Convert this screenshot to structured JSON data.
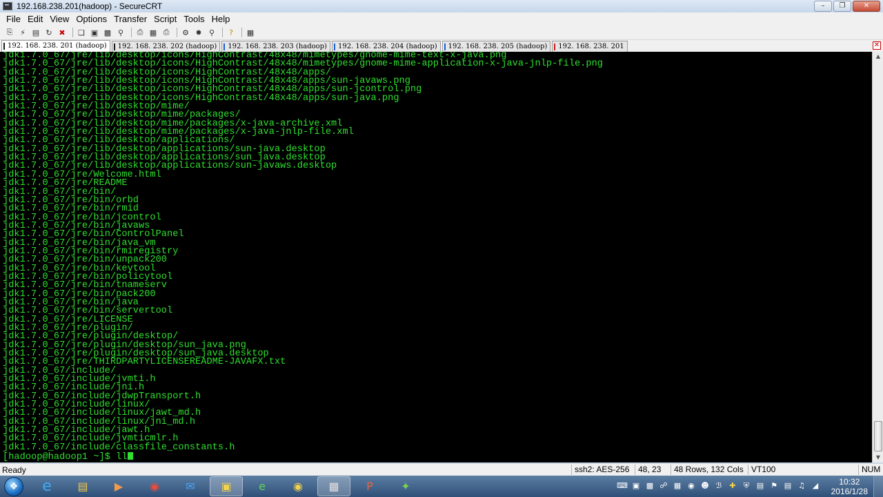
{
  "window": {
    "title": "192.168.238.201(hadoop) - SecureCRT",
    "controls": [
      "minimize",
      "maximize",
      "close"
    ]
  },
  "menu": [
    "File",
    "Edit",
    "View",
    "Options",
    "Transfer",
    "Script",
    "Tools",
    "Help"
  ],
  "toolbar": {
    "icons": [
      "connect-icon",
      "quick-connect-icon",
      "connect-in-tab-icon",
      "reconnect-icon",
      "disconnect-icon",
      "copy-icon",
      "paste-icon",
      "copy-paste-icon",
      "find-icon",
      "print-icon",
      "print-selection-icon",
      "print-setup-icon",
      "session-options-icon",
      "global-options-icon",
      "keymap-icon",
      "help-icon",
      "sftp-icon"
    ]
  },
  "tabs": [
    {
      "label": "192. 168. 238. 201 (hadoop)",
      "active": true,
      "status_color": "#1a1a1a"
    },
    {
      "label": "192. 168. 238. 202 (hadoop)",
      "active": false,
      "status_color": "#1a1a1a"
    },
    {
      "label": "192. 168. 238. 203 (hadoop)",
      "active": false,
      "status_color": "#1a5fd6"
    },
    {
      "label": "192. 168. 238. 204 (hadoop)",
      "active": false,
      "status_color": "#1a5fd6"
    },
    {
      "label": "192. 168. 238. 205 (hadoop)",
      "active": false,
      "status_color": "#1a5fd6"
    },
    {
      "label": "192. 168. 238. 201",
      "active": false,
      "status_color": "#d01a1a"
    }
  ],
  "terminal": {
    "lines": [
      "jdk1.7.0_67/jre/lib/desktop/icons/HighContrast/48x48/mimetypes/gnome-mime-text-x-java.png",
      "jdk1.7.0_67/jre/lib/desktop/icons/HighContrast/48x48/mimetypes/gnome-mime-application-x-java-jnlp-file.png",
      "jdk1.7.0_67/jre/lib/desktop/icons/HighContrast/48x48/apps/",
      "jdk1.7.0_67/jre/lib/desktop/icons/HighContrast/48x48/apps/sun-javaws.png",
      "jdk1.7.0_67/jre/lib/desktop/icons/HighContrast/48x48/apps/sun-jcontrol.png",
      "jdk1.7.0_67/jre/lib/desktop/icons/HighContrast/48x48/apps/sun-java.png",
      "jdk1.7.0_67/jre/lib/desktop/mime/",
      "jdk1.7.0_67/jre/lib/desktop/mime/packages/",
      "jdk1.7.0_67/jre/lib/desktop/mime/packages/x-java-archive.xml",
      "jdk1.7.0_67/jre/lib/desktop/mime/packages/x-java-jnlp-file.xml",
      "jdk1.7.0_67/jre/lib/desktop/applications/",
      "jdk1.7.0_67/jre/lib/desktop/applications/sun-java.desktop",
      "jdk1.7.0_67/jre/lib/desktop/applications/sun_java.desktop",
      "jdk1.7.0_67/jre/lib/desktop/applications/sun-javaws.desktop",
      "jdk1.7.0_67/jre/Welcome.html",
      "jdk1.7.0_67/jre/README",
      "jdk1.7.0_67/jre/bin/",
      "jdk1.7.0_67/jre/bin/orbd",
      "jdk1.7.0_67/jre/bin/rmid",
      "jdk1.7.0_67/jre/bin/jcontrol",
      "jdk1.7.0_67/jre/bin/javaws",
      "jdk1.7.0_67/jre/bin/ControlPanel",
      "jdk1.7.0_67/jre/bin/java_vm",
      "jdk1.7.0_67/jre/bin/rmiregistry",
      "jdk1.7.0_67/jre/bin/unpack200",
      "jdk1.7.0_67/jre/bin/keytool",
      "jdk1.7.0_67/jre/bin/policytool",
      "jdk1.7.0_67/jre/bin/tnameserv",
      "jdk1.7.0_67/jre/bin/pack200",
      "jdk1.7.0_67/jre/bin/java",
      "jdk1.7.0_67/jre/bin/servertool",
      "jdk1.7.0_67/jre/LICENSE",
      "jdk1.7.0_67/jre/plugin/",
      "jdk1.7.0_67/jre/plugin/desktop/",
      "jdk1.7.0_67/jre/plugin/desktop/sun_java.png",
      "jdk1.7.0_67/jre/plugin/desktop/sun_java.desktop",
      "jdk1.7.0_67/jre/THIRDPARTYLICENSEREADME-JAVAFX.txt",
      "jdk1.7.0_67/include/",
      "jdk1.7.0_67/include/jvmti.h",
      "jdk1.7.0_67/include/jni.h",
      "jdk1.7.0_67/include/jdwpTransport.h",
      "jdk1.7.0_67/include/linux/",
      "jdk1.7.0_67/include/linux/jawt_md.h",
      "jdk1.7.0_67/include/linux/jni_md.h",
      "jdk1.7.0_67/include/jawt.h",
      "jdk1.7.0_67/include/jvmticmlr.h",
      "jdk1.7.0_67/include/classfile_constants.h"
    ],
    "prompt": "[hadoop@hadoop1 ~]$ ",
    "input": "ll",
    "text_color": "#2fe02f",
    "background": "#000000"
  },
  "statusbar": {
    "ready": "Ready",
    "cipher": "ssh2: AES-256",
    "cursor_pos": "48,  23",
    "size": "48 Rows, 132 Cols",
    "term_type": "VT100",
    "num": "NUM"
  },
  "taskbar": {
    "apps": [
      "ie-icon",
      "explorer-icon",
      "media-player-icon",
      "chrome-icon",
      "outlook-icon",
      "securecrt-icon",
      "360-browser-icon",
      "filezilla-icon",
      "app-window-icon",
      "powerpoint-icon",
      "green-app-icon"
    ],
    "clock_time": "10:32",
    "clock_date": "2016/1/28"
  }
}
